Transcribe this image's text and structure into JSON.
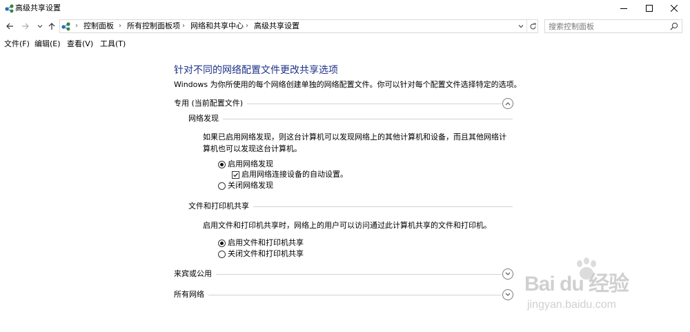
{
  "window": {
    "title": "高级共享设置",
    "controls": {
      "minimize": "minimize",
      "maximize": "maximize",
      "close": "close"
    }
  },
  "nav": {
    "breadcrumb": [
      "控制面板",
      "所有控制面板项",
      "网络和共享中心",
      "高级共享设置"
    ],
    "search_placeholder": "搜索控制面板"
  },
  "menu": [
    "文件(F)",
    "编辑(E)",
    "查看(V)",
    "工具(T)"
  ],
  "content": {
    "title": "针对不同的网络配置文件更改共享选项",
    "description": "Windows 为你所使用的每个网络创建单独的网络配置文件。你可以针对每个配置文件选择特定的选项。",
    "profiles": {
      "private": {
        "label": "专用 (当前配置文件)",
        "expanded": true,
        "network_discovery": {
          "heading": "网络发现",
          "description": "如果已启用网络发现，则这台计算机可以发现网络上的其他计算机和设备，而且其他网络计算机也可以发现这台计算机。",
          "on_label": "启用网络发现",
          "auto_setup_label": "启用网络连接设备的自动设置。",
          "off_label": "关闭网络发现",
          "selected": "on",
          "auto_setup_checked": true
        },
        "file_printer_sharing": {
          "heading": "文件和打印机共享",
          "description": "启用文件和打印机共享时，网络上的用户可以访问通过此计算机共享的文件和打印机。",
          "on_label": "启用文件和打印机共享",
          "off_label": "关闭文件和打印机共享",
          "selected": "on"
        }
      },
      "guest_public": {
        "label": "来宾或公用",
        "expanded": false
      },
      "all_networks": {
        "label": "所有网络",
        "expanded": false
      }
    }
  },
  "watermark": {
    "brand": "Bai du 经验",
    "url": "jingyan.baidu.com"
  },
  "colors": {
    "title_blue": "#1e3287",
    "network_icon_green": "#2f8a3a",
    "network_icon_blue": "#2b6cb0",
    "watermark_gray": "#d0d0d0"
  }
}
